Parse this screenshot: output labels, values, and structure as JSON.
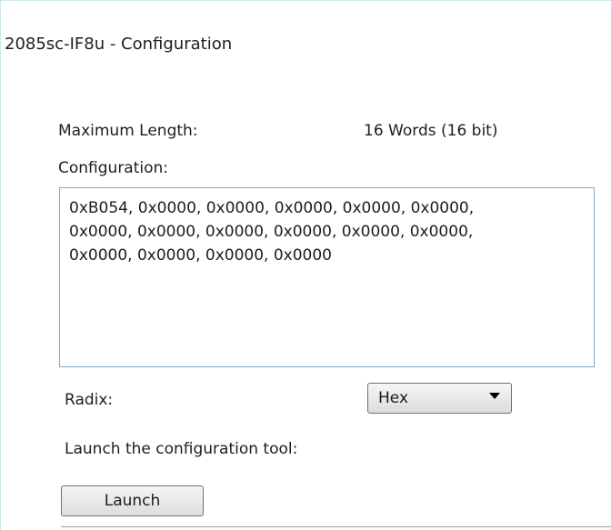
{
  "header": {
    "title": "2085sc-IF8u - Configuration"
  },
  "max_length": {
    "label": "Maximum Length:",
    "value": "16  Words (16 bit)"
  },
  "configuration": {
    "label": "Configuration:",
    "value": "0xB054, 0x0000, 0x0000, 0x0000, 0x0000, 0x0000,\n0x0000, 0x0000, 0x0000, 0x0000, 0x0000, 0x0000,\n0x0000, 0x0000, 0x0000, 0x0000"
  },
  "radix": {
    "label": "Radix:",
    "selected": "Hex"
  },
  "launch": {
    "label": "Launch the configuration tool:",
    "button": "Launch"
  },
  "colors": {
    "border_accent": "#cfe5ec",
    "text_border": "#86a6c4"
  },
  "icons": {
    "dropdown": "chevron-down-icon"
  }
}
